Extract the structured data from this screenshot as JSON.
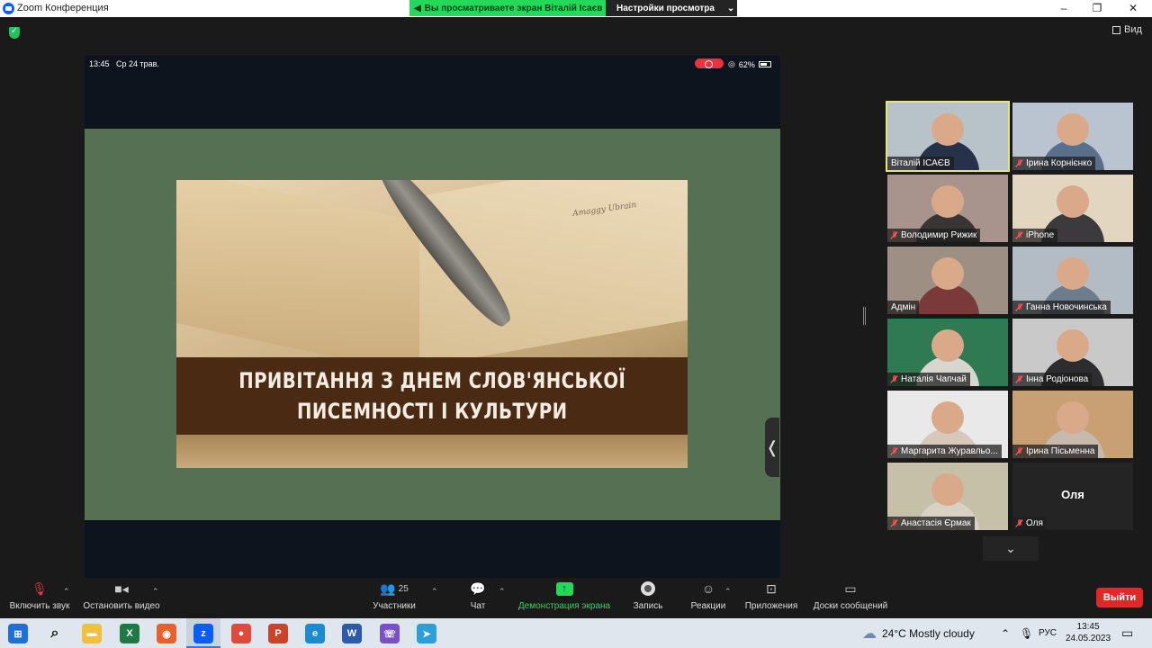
{
  "window": {
    "title": "Zoom Конференция",
    "controls": [
      "–",
      "❐",
      "✕"
    ]
  },
  "share_banner": {
    "viewing_text": "Вы просматриваете экран Віталій Ісаєв",
    "settings_label": "Настройки просмотра",
    "settings_chevron": "⌄"
  },
  "view_button": {
    "label": "Вид"
  },
  "shared_screen": {
    "status": {
      "time": "13:45",
      "date": "Ср 24 трав.",
      "battery": "62%"
    },
    "slide": {
      "script_text": "Amaggy Ubrain",
      "title_line1": "ПРИВІТАННЯ З ДНЕМ СЛОВ'ЯНСЬКОЇ",
      "title_line2": "ПИСЕМНОСТІ І КУЛЬТУРИ"
    },
    "collapse_chevron": "❬"
  },
  "participants": [
    {
      "name": "Віталій ІСАЄВ",
      "muted": false,
      "active": true,
      "bg": "#b8c3c9",
      "body": "#27324a"
    },
    {
      "name": "Ірина Корнієнко",
      "muted": true,
      "active": false,
      "bg": "#b9c4d0",
      "body": "#5a6f8a"
    },
    {
      "name": "Володимир Рижик",
      "muted": true,
      "active": false,
      "bg": "#a8948c",
      "body": "#3a3535"
    },
    {
      "name": "iPhone",
      "muted": true,
      "active": false,
      "bg": "#e2d6c0",
      "body": "#3c3a3c"
    },
    {
      "name": "Адмін",
      "muted": false,
      "active": false,
      "bg": "#9d8f83",
      "body": "#7a3a3a"
    },
    {
      "name": "Ганна Новочинська",
      "muted": true,
      "active": false,
      "bg": "#b3bcc4",
      "body": "#6d7d8c"
    },
    {
      "name": "Наталія Чапчай",
      "muted": true,
      "active": false,
      "bg": "#2f7a52",
      "body": "#d7d7d0"
    },
    {
      "name": "Інна Родіонова",
      "muted": true,
      "active": false,
      "bg": "#c9c9c9",
      "body": "#2d2d30"
    },
    {
      "name": "Маргарита Журавльо...",
      "muted": true,
      "active": false,
      "bg": "#e9e9e9",
      "body": "#d6c8bb"
    },
    {
      "name": "Ірина Пісьменна",
      "muted": true,
      "active": false,
      "bg": "#c8a074",
      "body": "#c7b9ad"
    },
    {
      "name": "Анастасія Єрмак",
      "muted": true,
      "active": false,
      "bg": "#c7c0a8",
      "body": "#d9d2c4"
    },
    {
      "name": "Оля",
      "muted": true,
      "active": false,
      "bg": "#242424",
      "body": "",
      "avatar_text": "Оля"
    }
  ],
  "more_participants_chevron": "⌄",
  "toolbar": {
    "unmute": "Включить звук",
    "stop_video": "Остановить видео",
    "participants": "Участники",
    "participants_count": "25",
    "chat": "Чат",
    "share": "Демонстрация экрана",
    "record": "Запись",
    "reactions": "Реакции",
    "apps": "Приложения",
    "whiteboards": "Доски сообщений",
    "exit": "Выйти",
    "caret": "⌃"
  },
  "taskbar": {
    "weather": "24°C  Mostly cloudy",
    "lang": "РУС",
    "time": "13:45",
    "date": "24.05.2023",
    "apps": [
      {
        "name": "windows-start",
        "color": "#1f6fd6",
        "glyph": "⊞"
      },
      {
        "name": "search",
        "color": "#dfe6ee",
        "glyph": "⌕"
      },
      {
        "name": "file-explorer",
        "color": "#f1c13d",
        "glyph": "▬"
      },
      {
        "name": "excel",
        "color": "#1d7a45",
        "glyph": "X"
      },
      {
        "name": "firefox",
        "color": "#e8602c",
        "glyph": "◉"
      },
      {
        "name": "zoom",
        "color": "#0b5cff",
        "glyph": "z"
      },
      {
        "name": "chrome",
        "color": "#e04a3a",
        "glyph": "●"
      },
      {
        "name": "powerpoint",
        "color": "#c9442a",
        "glyph": "P"
      },
      {
        "name": "edge",
        "color": "#1b8ad0",
        "glyph": "e"
      },
      {
        "name": "word",
        "color": "#2b5ba8",
        "glyph": "W"
      },
      {
        "name": "viber",
        "color": "#7a50c4",
        "glyph": "☏"
      },
      {
        "name": "telegram",
        "color": "#2a9fd8",
        "glyph": "➤"
      }
    ]
  }
}
